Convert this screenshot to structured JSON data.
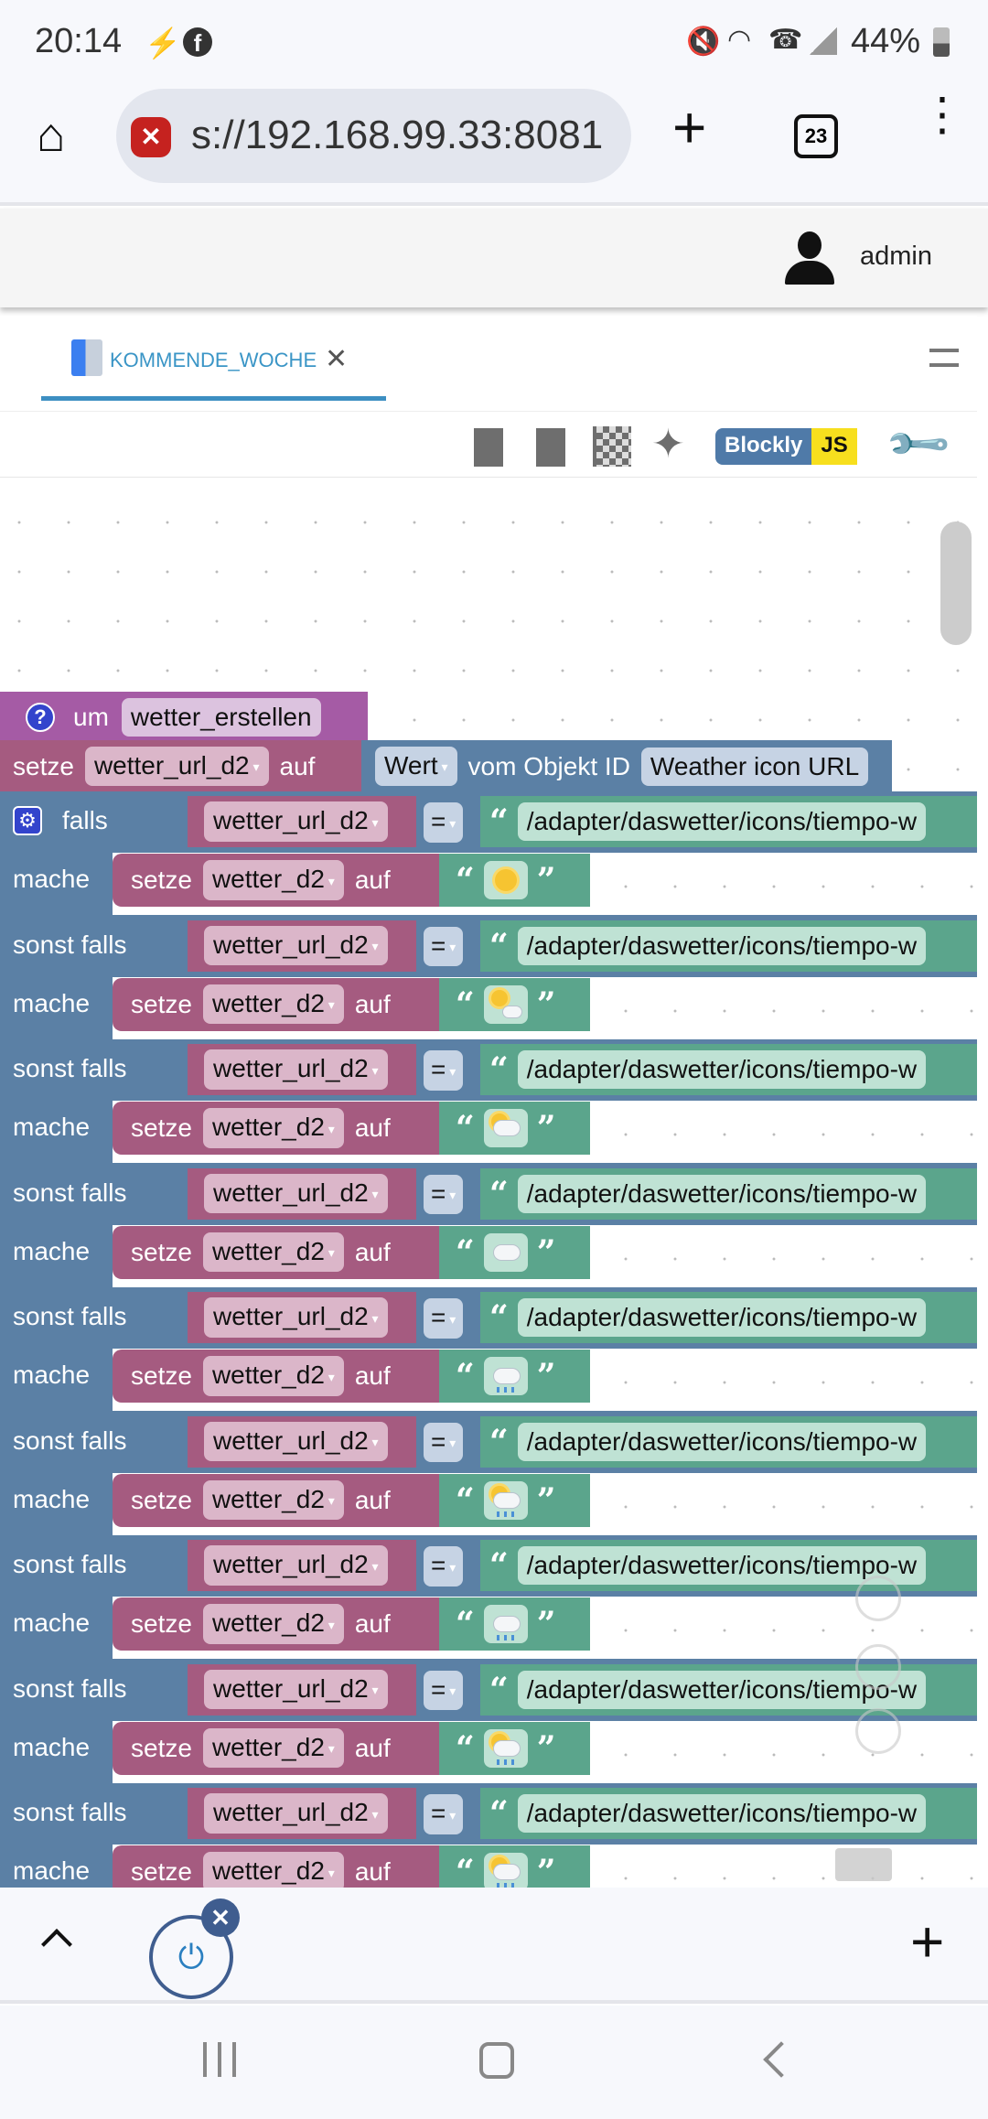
{
  "status": {
    "time": "20:14",
    "battery": "44%",
    "icons": [
      "flash-icon",
      "facebook-icon",
      "mute-icon",
      "wifi-icon",
      "wifi-call-icon",
      "signal-icon",
      "battery-icon"
    ]
  },
  "browser": {
    "url": "s://192.168.99.33:8081",
    "tab_count": "23"
  },
  "header": {
    "user": "admin"
  },
  "tabs": [
    {
      "label": "KOMMENDE_WOCHE",
      "active": true
    }
  ],
  "toolbar": {
    "blockly": "Blockly",
    "js": "JS"
  },
  "colors": {
    "procedure": "#a55ba5",
    "variable": "#a55b80",
    "logic": "#5b80a5",
    "text": "#5ba58c",
    "tab_accent": "#3d8fc2"
  },
  "blocks": {
    "procedure": {
      "keyword": "um",
      "name": "wetter_erstellen"
    },
    "set_url": {
      "setze": "setze",
      "var": "wetter_url_d2",
      "auf": "auf",
      "property": "Wert",
      "of_object": "vom Objekt ID",
      "object": "Weather icon URL"
    },
    "if": {
      "first": "falls",
      "elseif": "sonst falls",
      "do": "mache",
      "cond_var": "wetter_url_d2",
      "op": "=",
      "setze": "setze",
      "set_var": "wetter_d2",
      "auf": "auf",
      "url_prefix": "/adapter/daswetter/icons/tiempo-w",
      "branches": [
        {
          "icon": "sun"
        },
        {
          "icon": "sun-small-cloud"
        },
        {
          "icon": "sun-behind-cloud"
        },
        {
          "icon": "cloud"
        },
        {
          "icon": "cloud-rain"
        },
        {
          "icon": "sun-cloud-rain"
        },
        {
          "icon": "cloud-rain"
        },
        {
          "icon": "sun-cloud-rain"
        },
        {
          "icon": "sun-cloud-rain"
        }
      ]
    }
  }
}
